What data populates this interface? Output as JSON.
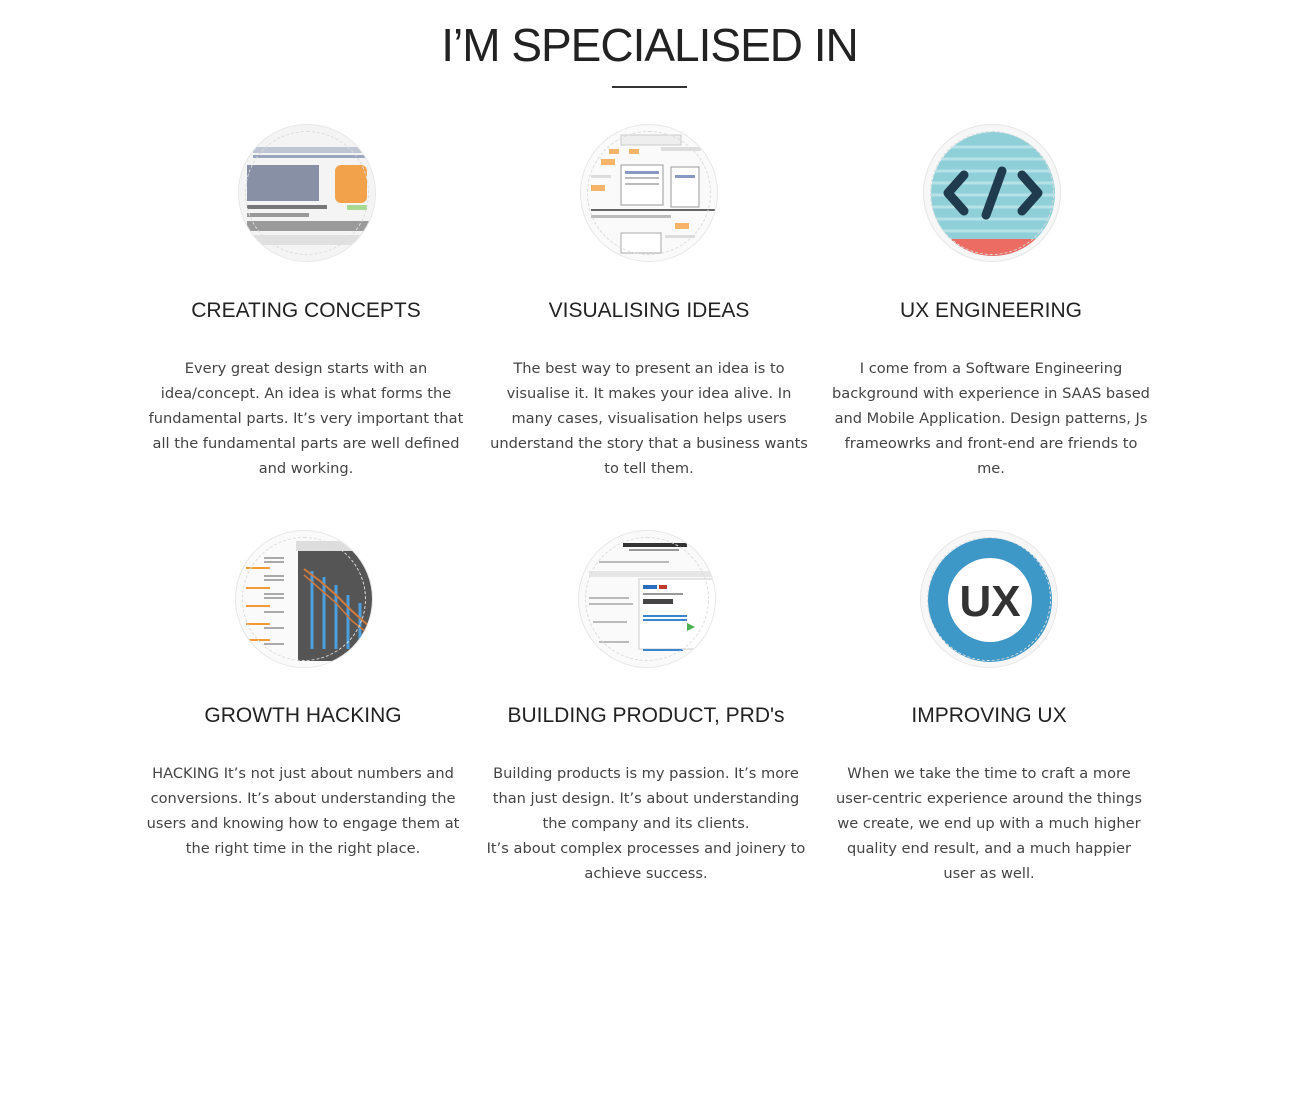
{
  "section": {
    "title": "I’M SPECIALISED IN"
  },
  "cards": [
    {
      "heading": "CREATING CONCEPTS",
      "body": "Every great design starts with an idea/concept. An idea is what forms the fundamental parts. It’s very important that all the fundamental parts are well defined and working.",
      "icon": "wireframe-thumbnail-icon"
    },
    {
      "heading": "VISUALISING IDEAS",
      "body": "The best way to present an idea is to visualise it. It makes your idea alive. In many cases, visualisation helps users understand the story that a business wants to tell them.",
      "icon": "flowchart-thumbnail-icon"
    },
    {
      "heading": "UX ENGINEERING",
      "body": "I come from a Software Engineering background with experience in SAAS based and Mobile Application. Design patterns, Js frameowrks and front-end are friends to me.",
      "icon": "code-brackets-icon"
    },
    {
      "heading": "GROWTH HACKING",
      "body": "HACKING It’s not just about numbers and conversions. It’s about understanding the users and knowing how to engage them at the right time in the right place.",
      "icon": "growth-chart-thumbnail-icon"
    },
    {
      "heading": "BUILDING PRODUCT, PRD's",
      "body_lines": [
        "Building products is my passion. It’s more than just design. It’s about understanding the company and its clients.",
        "It’s about complex processes and joinery to achieve success."
      ],
      "icon": "prd-document-thumbnail-icon"
    },
    {
      "heading": "IMPROVING UX",
      "body": "When we take the time to craft a more user-centric experience around the things we create, we end up with a much higher quality end result, and a much happier user as well.",
      "icon": "ux-badge-icon",
      "badge_text": "UX"
    }
  ],
  "colors": {
    "heading": "#222222",
    "body": "#444444",
    "code_teal": "#8fcfd8",
    "code_red": "#ec6b63",
    "ux_blue": "#3d97c7",
    "ux_text": "#333333"
  }
}
